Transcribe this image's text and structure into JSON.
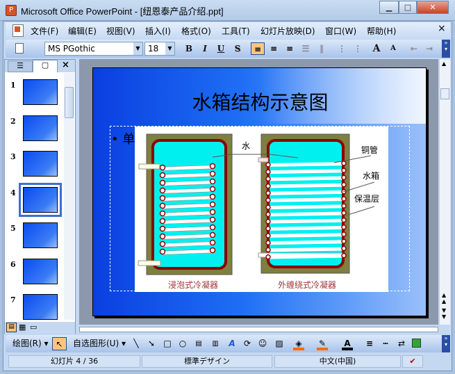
{
  "window": {
    "title": "Microsoft Office PowerPoint - [纽恩泰产品介绍.ppt]",
    "app_icon": "P",
    "minimize": "▁",
    "maximize": "□",
    "close": "✕"
  },
  "menu": [
    "文件(F)",
    "编辑(E)",
    "视图(V)",
    "插入(I)",
    "格式(O)",
    "工具(T)",
    "幻灯片放映(D)",
    "窗口(W)",
    "帮助(H)"
  ],
  "menu_close": "×",
  "toolbar": {
    "font": "MS PGothic",
    "size": "18",
    "bold": "B",
    "italic": "I",
    "underline": "U",
    "shadow": "S",
    "grow": "A",
    "shrink": "A"
  },
  "left_pane": {
    "close": "×",
    "slides": [
      "1",
      "2",
      "3",
      "4",
      "5",
      "6",
      "7"
    ],
    "selected": 4
  },
  "slide": {
    "title": "水箱结构示意图",
    "bullet": "单",
    "labels": {
      "water": "水",
      "copper_pipe": "铜管",
      "tank": "水箱",
      "insulation": "保温层"
    },
    "captions": [
      "浸泡式冷凝器",
      "外缠绕式冷凝器"
    ]
  },
  "drawing": {
    "draw": "绘图(R)",
    "autoshapes": "自选图形(U)",
    "fill_color": "#ff6a00",
    "line_color": "#ff6a00",
    "font_color": "#000000"
  },
  "status": {
    "slide": "幻灯片 4 / 36",
    "design": "標準デザイン",
    "language": "中文(中国)"
  },
  "colors": {
    "water": "#00f0f0",
    "insulation": "#7f7f3f",
    "tank_wall": "#8b0000"
  }
}
